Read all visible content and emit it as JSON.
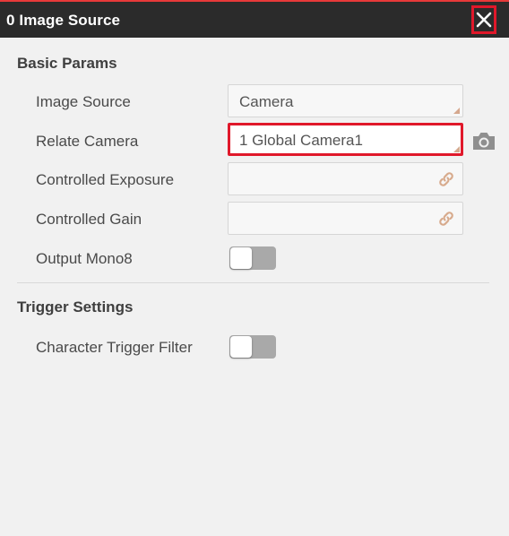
{
  "window": {
    "title": "0 Image Source",
    "close_icon": "close-icon",
    "accent_color": "#e0182a"
  },
  "basic_params": {
    "title": "Basic Params",
    "rows": [
      {
        "label": "Image Source",
        "value": "Camera",
        "control": "select"
      },
      {
        "label": "Relate Camera",
        "value": "1 Global Camera1",
        "control": "select",
        "highlighted": true
      },
      {
        "label": "Controlled Exposure",
        "value": "",
        "control": "link-field",
        "icon": "link-icon"
      },
      {
        "label": "Controlled Gain",
        "value": "",
        "control": "link-field",
        "icon": "link-icon"
      },
      {
        "label": "Output Mono8",
        "control": "toggle",
        "state": "off"
      }
    ],
    "camera_button_icon": "camera-icon"
  },
  "trigger_settings": {
    "title": "Trigger Settings",
    "rows": [
      {
        "label": "Character Trigger Filter",
        "control": "toggle",
        "state": "off"
      }
    ]
  }
}
